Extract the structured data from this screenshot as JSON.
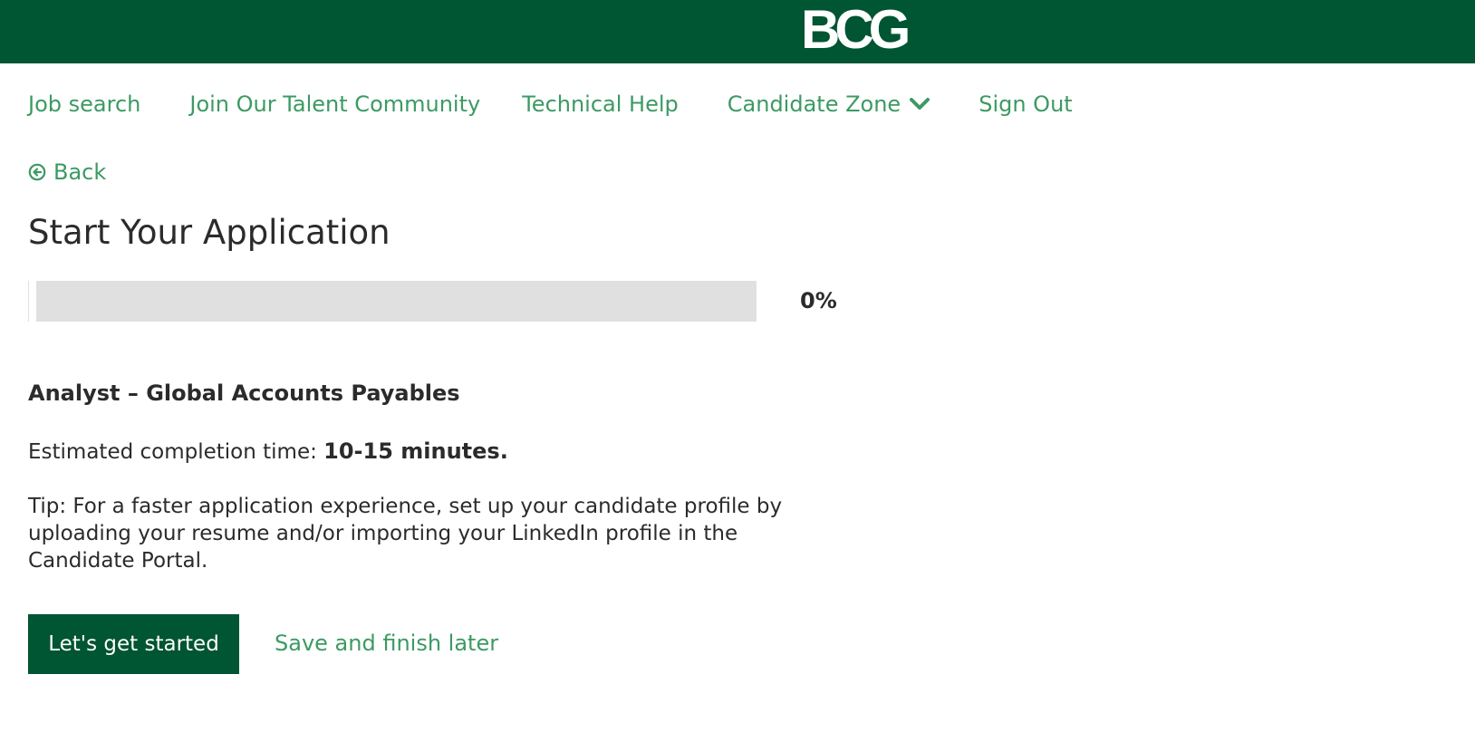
{
  "header": {
    "logo_text": "BCG",
    "brand_color": "#005532",
    "link_color": "#3c9a63"
  },
  "nav": {
    "items": [
      {
        "label": "Job search"
      },
      {
        "label": "Join Our Talent Community"
      },
      {
        "label": "Technical Help"
      },
      {
        "label": "Candidate Zone",
        "icon": "chevron-down-icon"
      },
      {
        "label": "Sign Out"
      }
    ]
  },
  "back": {
    "label": "Back",
    "icon": "arrow-circle-left-icon"
  },
  "page": {
    "title": "Start Your Application"
  },
  "progress": {
    "value_percent": 0,
    "label": "0%"
  },
  "job": {
    "title": "Analyst – Global Accounts Payables"
  },
  "estimate": {
    "prefix": "Estimated completion time: ",
    "value": "10-15 minutes."
  },
  "tip": {
    "text": "Tip: For a faster application experience, set up your candidate profile by uploading your resume and/or importing your LinkedIn profile in the Candidate Portal."
  },
  "actions": {
    "start_label": "Let's get started",
    "save_label": "Save and finish later"
  }
}
